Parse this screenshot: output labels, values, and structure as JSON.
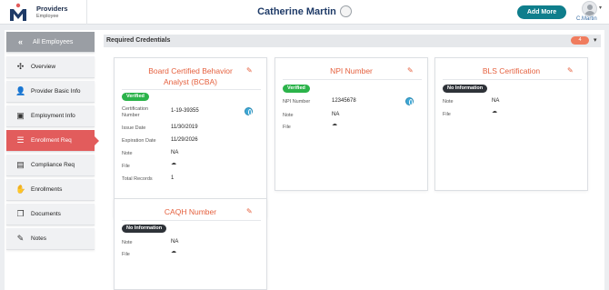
{
  "header": {
    "brand_title": "Providers",
    "brand_subtitle": "Employee",
    "user_name": "Catherine Martin",
    "add_more_label": "Add More",
    "account_name": "C.Martin"
  },
  "section": {
    "title": "Required Credentials",
    "count": "4"
  },
  "sidebar": {
    "items": [
      {
        "label": "All Employees",
        "icon": "double-chevron-left-icon"
      },
      {
        "label": "Overview",
        "icon": "network-icon"
      },
      {
        "label": "Provider Basic Info",
        "icon": "user-info-icon"
      },
      {
        "label": "Employment Info",
        "icon": "id-card-icon"
      },
      {
        "label": "Enrollment Req",
        "icon": "list-check-icon"
      },
      {
        "label": "Compliance Req",
        "icon": "clipboard-icon"
      },
      {
        "label": "Enrollments",
        "icon": "hand-user-icon"
      },
      {
        "label": "Documents",
        "icon": "documents-icon"
      },
      {
        "label": "Notes",
        "icon": "note-icon"
      }
    ]
  },
  "cards": {
    "bcba": {
      "title_line1": "Board Certified Behavior",
      "title_line2": "Analyst (BCBA)",
      "status": "Verified",
      "cert_label_1": "Certification",
      "cert_label_2": "Number",
      "cert_value": "1-19-39355",
      "issue_label": "Issue Date",
      "issue_value": "11/30/2019",
      "exp_label": "Expiration Date",
      "exp_value": "11/29/2026",
      "note_label": "Note",
      "note_value": "NA",
      "file_label": "File",
      "total_label": "Total Records",
      "total_value": "1"
    },
    "npi": {
      "title": "NPI Number",
      "status": "Verified",
      "npi_label": "NPI Number",
      "npi_value": "12345678",
      "note_label": "Note",
      "note_value": "NA",
      "file_label": "File"
    },
    "bls": {
      "title": "BLS Certification",
      "status": "No Information",
      "note_label": "Note",
      "note_value": "NA",
      "file_label": "File"
    },
    "caqh": {
      "title": "CAQH Number",
      "status": "No Information",
      "note_label": "Note",
      "note_value": "NA",
      "file_label": "File"
    }
  },
  "colors": {
    "accent": "#e5613f",
    "active_nav": "#e25c5c",
    "primary_button": "#0f7e8c",
    "verified": "#2bb34a",
    "title_blue": "#1e3a67"
  }
}
